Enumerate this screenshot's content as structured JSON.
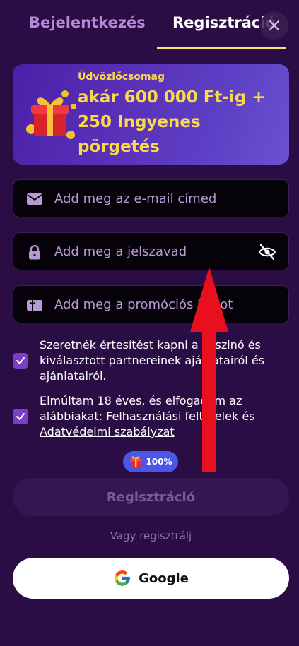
{
  "tabs": {
    "login": "Bejelentkezés",
    "register": "Regisztráció"
  },
  "promo": {
    "subtitle": "Üdvözlőcsomag",
    "headline": "akár 600 000 Ft-ig + 250 Ingyenes pörgetés"
  },
  "fields": {
    "email_placeholder": "Add meg az e-mail címed",
    "password_placeholder": "Add meg a jelszavad",
    "promo_placeholder": "Add meg a promóciós kódot"
  },
  "consents": {
    "marketing": "Szeretnék értesítést kapni a kaszinó és kiválasztott partnereinek ajánlatairól és ajánlatairól.",
    "age_prefix": "Elmúltam 18 éves, és elfogadom az alábbiakat: ",
    "terms_link": "Felhasználási feltételek",
    "and": " és ",
    "privacy_link": "Adatvédelmi szabályzat"
  },
  "register": {
    "badge": "100%",
    "button": "Regisztráció"
  },
  "social": {
    "or_text": "Vagy regisztrálj",
    "google": "Google"
  },
  "colors": {
    "background": "#2a0d44",
    "accent_yellow": "#f9d94c",
    "checkbox": "#7a3fc4",
    "badge": "#4a56e6",
    "annotation_arrow": "#e8101c"
  }
}
